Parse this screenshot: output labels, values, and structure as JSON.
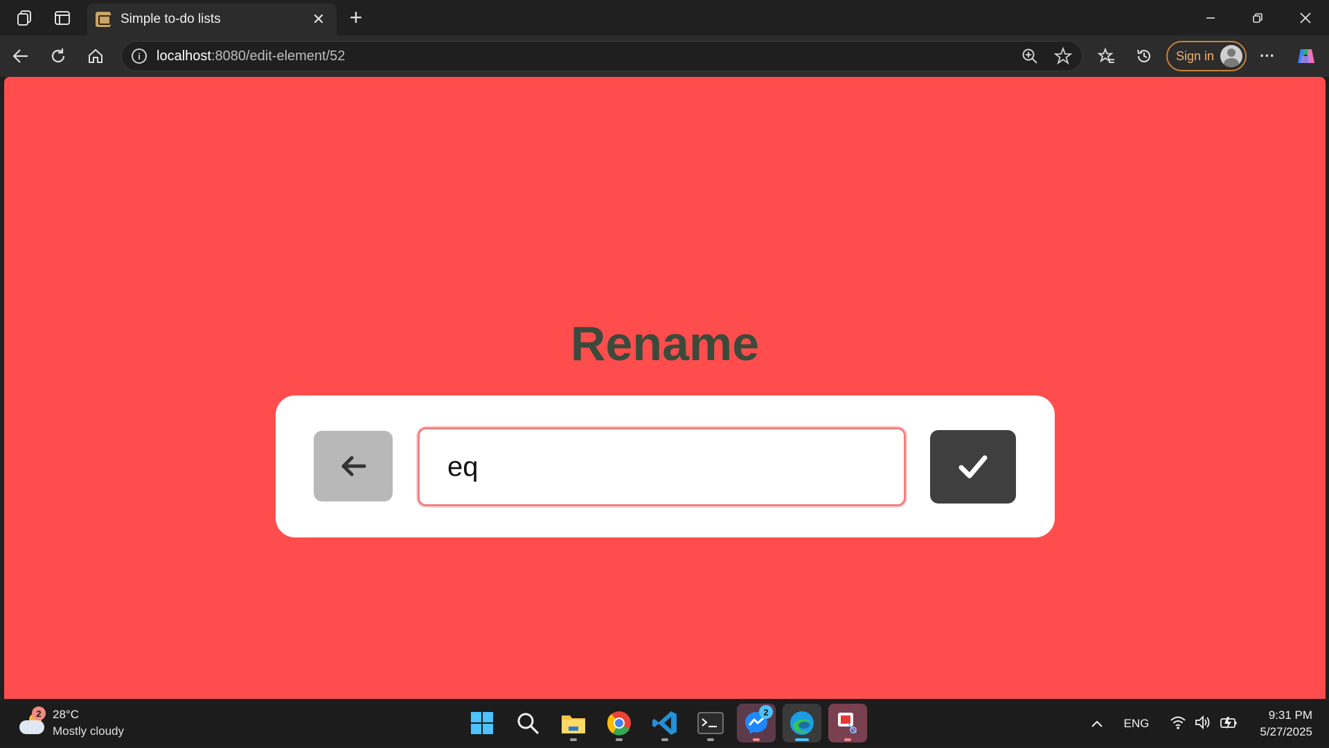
{
  "browser": {
    "tab_title": "Simple to-do lists",
    "tab_close": "✕",
    "new_tab": "+",
    "url_host": "localhost",
    "url_rest": ":8080/edit-element/52",
    "sign_in_label": "Sign in",
    "more_label": "···"
  },
  "page": {
    "heading": "Rename",
    "input_value": "eq",
    "back_icon": "arrow-left-icon",
    "confirm_icon": "checkmark-icon",
    "background_color": "#ff4d4d"
  },
  "taskbar": {
    "weather_badge": "2",
    "weather_temp": "28°C",
    "weather_condition": "Mostly cloudy",
    "messenger_badge": "2",
    "language": "ENG",
    "time": "9:31 PM",
    "date": "5/27/2025"
  }
}
